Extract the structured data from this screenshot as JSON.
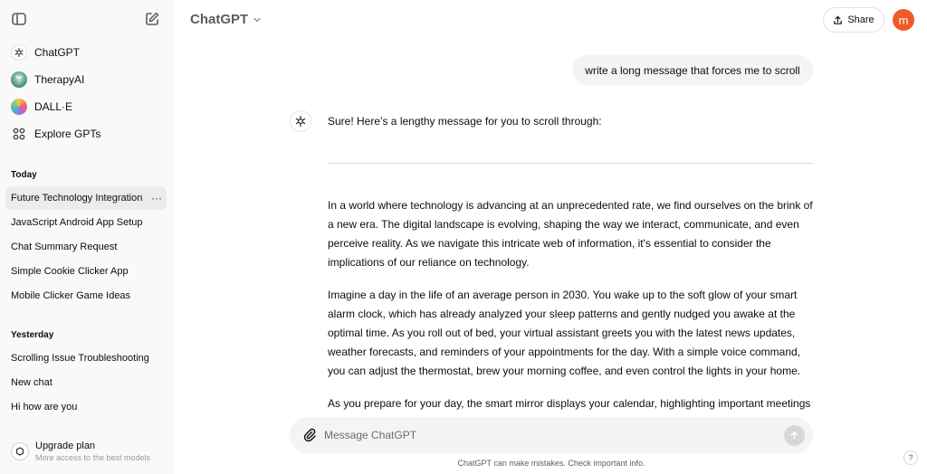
{
  "app": {
    "title": "ChatGPT"
  },
  "header": {
    "model_label": "ChatGPT",
    "share_label": "Share",
    "avatar_letter": "m"
  },
  "sidebar": {
    "gpts": [
      {
        "label": "ChatGPT",
        "icon": "openai-logo-icon"
      },
      {
        "label": "TherapyAI",
        "icon": "therapyai-avatar"
      },
      {
        "label": "DALL·E",
        "icon": "dalle-avatar"
      },
      {
        "label": "Explore GPTs",
        "icon": "grid-icon"
      }
    ],
    "sections": [
      {
        "label": "Today",
        "items": [
          {
            "label": "Future Technology Integration",
            "active": true
          },
          {
            "label": "JavaScript Android App Setup"
          },
          {
            "label": "Chat Summary Request"
          },
          {
            "label": "Simple Cookie Clicker App"
          },
          {
            "label": "Mobile Clicker Game Ideas"
          }
        ]
      },
      {
        "label": "Yesterday",
        "items": [
          {
            "label": "Scrolling Issue Troubleshooting"
          },
          {
            "label": "New chat"
          },
          {
            "label": "Hi how are you"
          }
        ]
      }
    ],
    "more_label": "···",
    "upgrade": {
      "title": "Upgrade plan",
      "subtitle": "More access to the best models"
    }
  },
  "conversation": {
    "user_message": "write a long message that forces me to scroll",
    "assistant_intro": "Sure! Here’s a lengthy message for you to scroll through:",
    "assistant_paragraphs": [
      "In a world where technology is advancing at an unprecedented rate, we find ourselves on the brink of a new era. The digital landscape is evolving, shaping the way we interact, communicate, and even perceive reality. As we navigate this intricate web of information, it's essential to consider the implications of our reliance on technology.",
      "Imagine a day in the life of an average person in 2030. You wake up to the soft glow of your smart alarm clock, which has already analyzed your sleep patterns and gently nudged you awake at the optimal time. As you roll out of bed, your virtual assistant greets you with the latest news updates, weather forecasts, and reminders of your appointments for the day. With a simple voice command, you can adjust the thermostat, brew your morning coffee, and even control the lights in your home.",
      "As you prepare for your day, the smart mirror displays your calendar, highlighting important meetings"
    ]
  },
  "composer": {
    "placeholder": "Message ChatGPT"
  },
  "footer": {
    "disclaimer": "ChatGPT can make mistakes. Check important info.",
    "help_label": "?"
  },
  "colors": {
    "avatar": "#f05a28",
    "sidebar_bg": "#f9f9f9",
    "bubble_bg": "#f4f4f4",
    "active_item": "#ececec"
  }
}
